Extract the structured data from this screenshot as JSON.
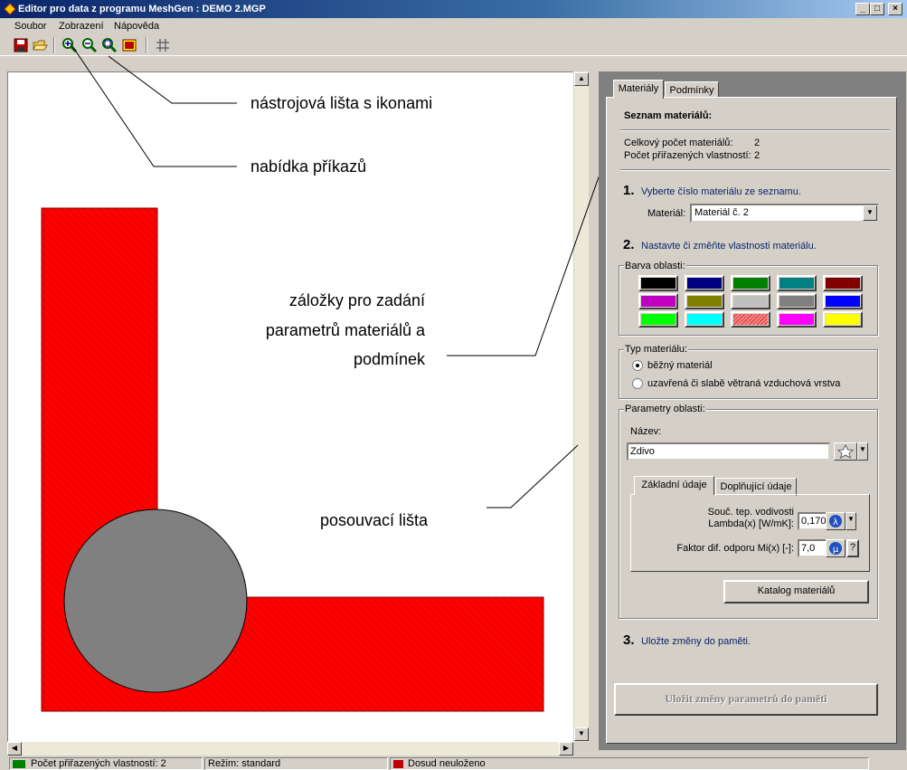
{
  "window": {
    "title": "Editor pro data z programu MeshGen : DEMO 2.MGP",
    "minimize": "_",
    "maximize": "□",
    "close": "×"
  },
  "menu": [
    "Soubor",
    "Zobrazení",
    "Nápověda"
  ],
  "toolbar_icons": [
    "save-icon",
    "open-icon",
    "zoom-in-icon",
    "zoom-out-icon",
    "zoom-region-icon",
    "zoom-fit-icon",
    "grid-icon"
  ],
  "canvas": {
    "region_color": "#ff0000",
    "circle_color": "#808080",
    "pattern": "diagonal-hatch"
  },
  "annotations": {
    "toolbar": "nástrojová lišta s ikonami",
    "menu": "nabídka příkazů",
    "tabs": [
      "záložky pro zadání",
      "parametrů materiálů a",
      "podmínek"
    ],
    "scrollbar": "posouvací lišta"
  },
  "panel": {
    "tabs": [
      "Materiály",
      "Podmínky"
    ],
    "heading": "Seznam materiálů:",
    "count_label": "Celkový počet materiálů:",
    "count_value": "2",
    "assigned_label": "Počet přiřazených vlastností:",
    "assigned_value": "2",
    "step1": {
      "num": "1.",
      "text": "Vyberte číslo materiálu ze seznamu."
    },
    "material_label": "Materiál:",
    "material_value": "Materiál č. 2",
    "step2": {
      "num": "2.",
      "text": "Nastavte či změňte vlastnosti materiálu."
    },
    "color_group": "Barva oblasti:",
    "colors": [
      "#000000",
      "#000080",
      "#008000",
      "#008080",
      "#800000",
      "#c000c0",
      "#808000",
      "#c0c0c0",
      "#808080",
      "#0000ff",
      "#00ff00",
      "#00ffff",
      "#ff8080",
      "#ff00ff",
      "#ffff00"
    ],
    "type_group": "Typ materiálu:",
    "type_options": [
      "běžný materiál",
      "uzavřená či slabě větraná vzduchová vrstva"
    ],
    "params_group": "Parametry oblasti:",
    "name_label": "Název:",
    "name_value": "Zdivo",
    "subtabs": [
      "Základní údaje",
      "Doplňující údaje"
    ],
    "lambda_label_1": "Souč. tep. vodivosti",
    "lambda_label_2": "Lambda(x) [W/mK]:",
    "lambda_value": "0,170",
    "mi_label": "Faktor dif. odporu Mi(x) [-]:",
    "mi_value": "7,0",
    "mi_help": "?",
    "catalog_button": "Katalog materiálů",
    "step3": {
      "num": "3.",
      "text": "Uložte změny do paměti."
    },
    "save_button": "Uložit změny parametrů do paměti"
  },
  "status": {
    "assigned": "Počet přiřazených vlastností: 2",
    "mode": "Režim: standard",
    "saved": "Dosud neuloženo"
  }
}
